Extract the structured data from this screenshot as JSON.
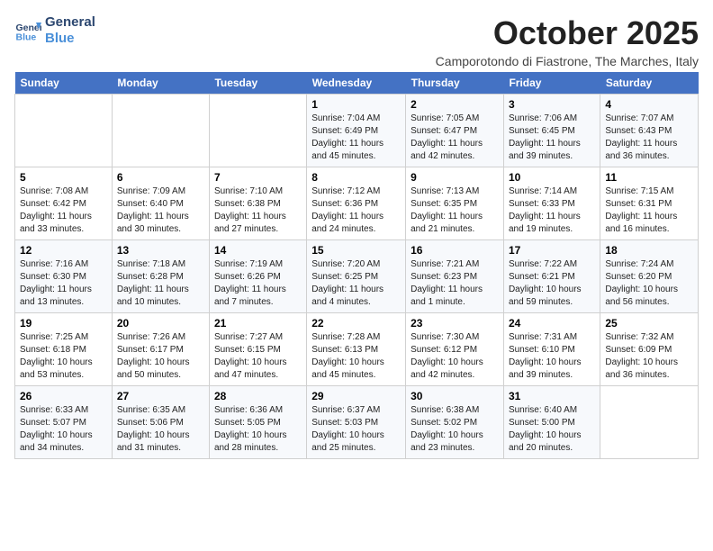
{
  "header": {
    "logo_line1": "General",
    "logo_line2": "Blue",
    "month_title": "October 2025",
    "location": "Camporotondo di Fiastrone, The Marches, Italy"
  },
  "weekdays": [
    "Sunday",
    "Monday",
    "Tuesday",
    "Wednesday",
    "Thursday",
    "Friday",
    "Saturday"
  ],
  "weeks": [
    [
      {
        "num": "",
        "info": ""
      },
      {
        "num": "",
        "info": ""
      },
      {
        "num": "",
        "info": ""
      },
      {
        "num": "1",
        "info": "Sunrise: 7:04 AM\nSunset: 6:49 PM\nDaylight: 11 hours and 45 minutes."
      },
      {
        "num": "2",
        "info": "Sunrise: 7:05 AM\nSunset: 6:47 PM\nDaylight: 11 hours and 42 minutes."
      },
      {
        "num": "3",
        "info": "Sunrise: 7:06 AM\nSunset: 6:45 PM\nDaylight: 11 hours and 39 minutes."
      },
      {
        "num": "4",
        "info": "Sunrise: 7:07 AM\nSunset: 6:43 PM\nDaylight: 11 hours and 36 minutes."
      }
    ],
    [
      {
        "num": "5",
        "info": "Sunrise: 7:08 AM\nSunset: 6:42 PM\nDaylight: 11 hours and 33 minutes."
      },
      {
        "num": "6",
        "info": "Sunrise: 7:09 AM\nSunset: 6:40 PM\nDaylight: 11 hours and 30 minutes."
      },
      {
        "num": "7",
        "info": "Sunrise: 7:10 AM\nSunset: 6:38 PM\nDaylight: 11 hours and 27 minutes."
      },
      {
        "num": "8",
        "info": "Sunrise: 7:12 AM\nSunset: 6:36 PM\nDaylight: 11 hours and 24 minutes."
      },
      {
        "num": "9",
        "info": "Sunrise: 7:13 AM\nSunset: 6:35 PM\nDaylight: 11 hours and 21 minutes."
      },
      {
        "num": "10",
        "info": "Sunrise: 7:14 AM\nSunset: 6:33 PM\nDaylight: 11 hours and 19 minutes."
      },
      {
        "num": "11",
        "info": "Sunrise: 7:15 AM\nSunset: 6:31 PM\nDaylight: 11 hours and 16 minutes."
      }
    ],
    [
      {
        "num": "12",
        "info": "Sunrise: 7:16 AM\nSunset: 6:30 PM\nDaylight: 11 hours and 13 minutes."
      },
      {
        "num": "13",
        "info": "Sunrise: 7:18 AM\nSunset: 6:28 PM\nDaylight: 11 hours and 10 minutes."
      },
      {
        "num": "14",
        "info": "Sunrise: 7:19 AM\nSunset: 6:26 PM\nDaylight: 11 hours and 7 minutes."
      },
      {
        "num": "15",
        "info": "Sunrise: 7:20 AM\nSunset: 6:25 PM\nDaylight: 11 hours and 4 minutes."
      },
      {
        "num": "16",
        "info": "Sunrise: 7:21 AM\nSunset: 6:23 PM\nDaylight: 11 hours and 1 minute."
      },
      {
        "num": "17",
        "info": "Sunrise: 7:22 AM\nSunset: 6:21 PM\nDaylight: 10 hours and 59 minutes."
      },
      {
        "num": "18",
        "info": "Sunrise: 7:24 AM\nSunset: 6:20 PM\nDaylight: 10 hours and 56 minutes."
      }
    ],
    [
      {
        "num": "19",
        "info": "Sunrise: 7:25 AM\nSunset: 6:18 PM\nDaylight: 10 hours and 53 minutes."
      },
      {
        "num": "20",
        "info": "Sunrise: 7:26 AM\nSunset: 6:17 PM\nDaylight: 10 hours and 50 minutes."
      },
      {
        "num": "21",
        "info": "Sunrise: 7:27 AM\nSunset: 6:15 PM\nDaylight: 10 hours and 47 minutes."
      },
      {
        "num": "22",
        "info": "Sunrise: 7:28 AM\nSunset: 6:13 PM\nDaylight: 10 hours and 45 minutes."
      },
      {
        "num": "23",
        "info": "Sunrise: 7:30 AM\nSunset: 6:12 PM\nDaylight: 10 hours and 42 minutes."
      },
      {
        "num": "24",
        "info": "Sunrise: 7:31 AM\nSunset: 6:10 PM\nDaylight: 10 hours and 39 minutes."
      },
      {
        "num": "25",
        "info": "Sunrise: 7:32 AM\nSunset: 6:09 PM\nDaylight: 10 hours and 36 minutes."
      }
    ],
    [
      {
        "num": "26",
        "info": "Sunrise: 6:33 AM\nSunset: 5:07 PM\nDaylight: 10 hours and 34 minutes."
      },
      {
        "num": "27",
        "info": "Sunrise: 6:35 AM\nSunset: 5:06 PM\nDaylight: 10 hours and 31 minutes."
      },
      {
        "num": "28",
        "info": "Sunrise: 6:36 AM\nSunset: 5:05 PM\nDaylight: 10 hours and 28 minutes."
      },
      {
        "num": "29",
        "info": "Sunrise: 6:37 AM\nSunset: 5:03 PM\nDaylight: 10 hours and 25 minutes."
      },
      {
        "num": "30",
        "info": "Sunrise: 6:38 AM\nSunset: 5:02 PM\nDaylight: 10 hours and 23 minutes."
      },
      {
        "num": "31",
        "info": "Sunrise: 6:40 AM\nSunset: 5:00 PM\nDaylight: 10 hours and 20 minutes."
      },
      {
        "num": "",
        "info": ""
      }
    ]
  ]
}
